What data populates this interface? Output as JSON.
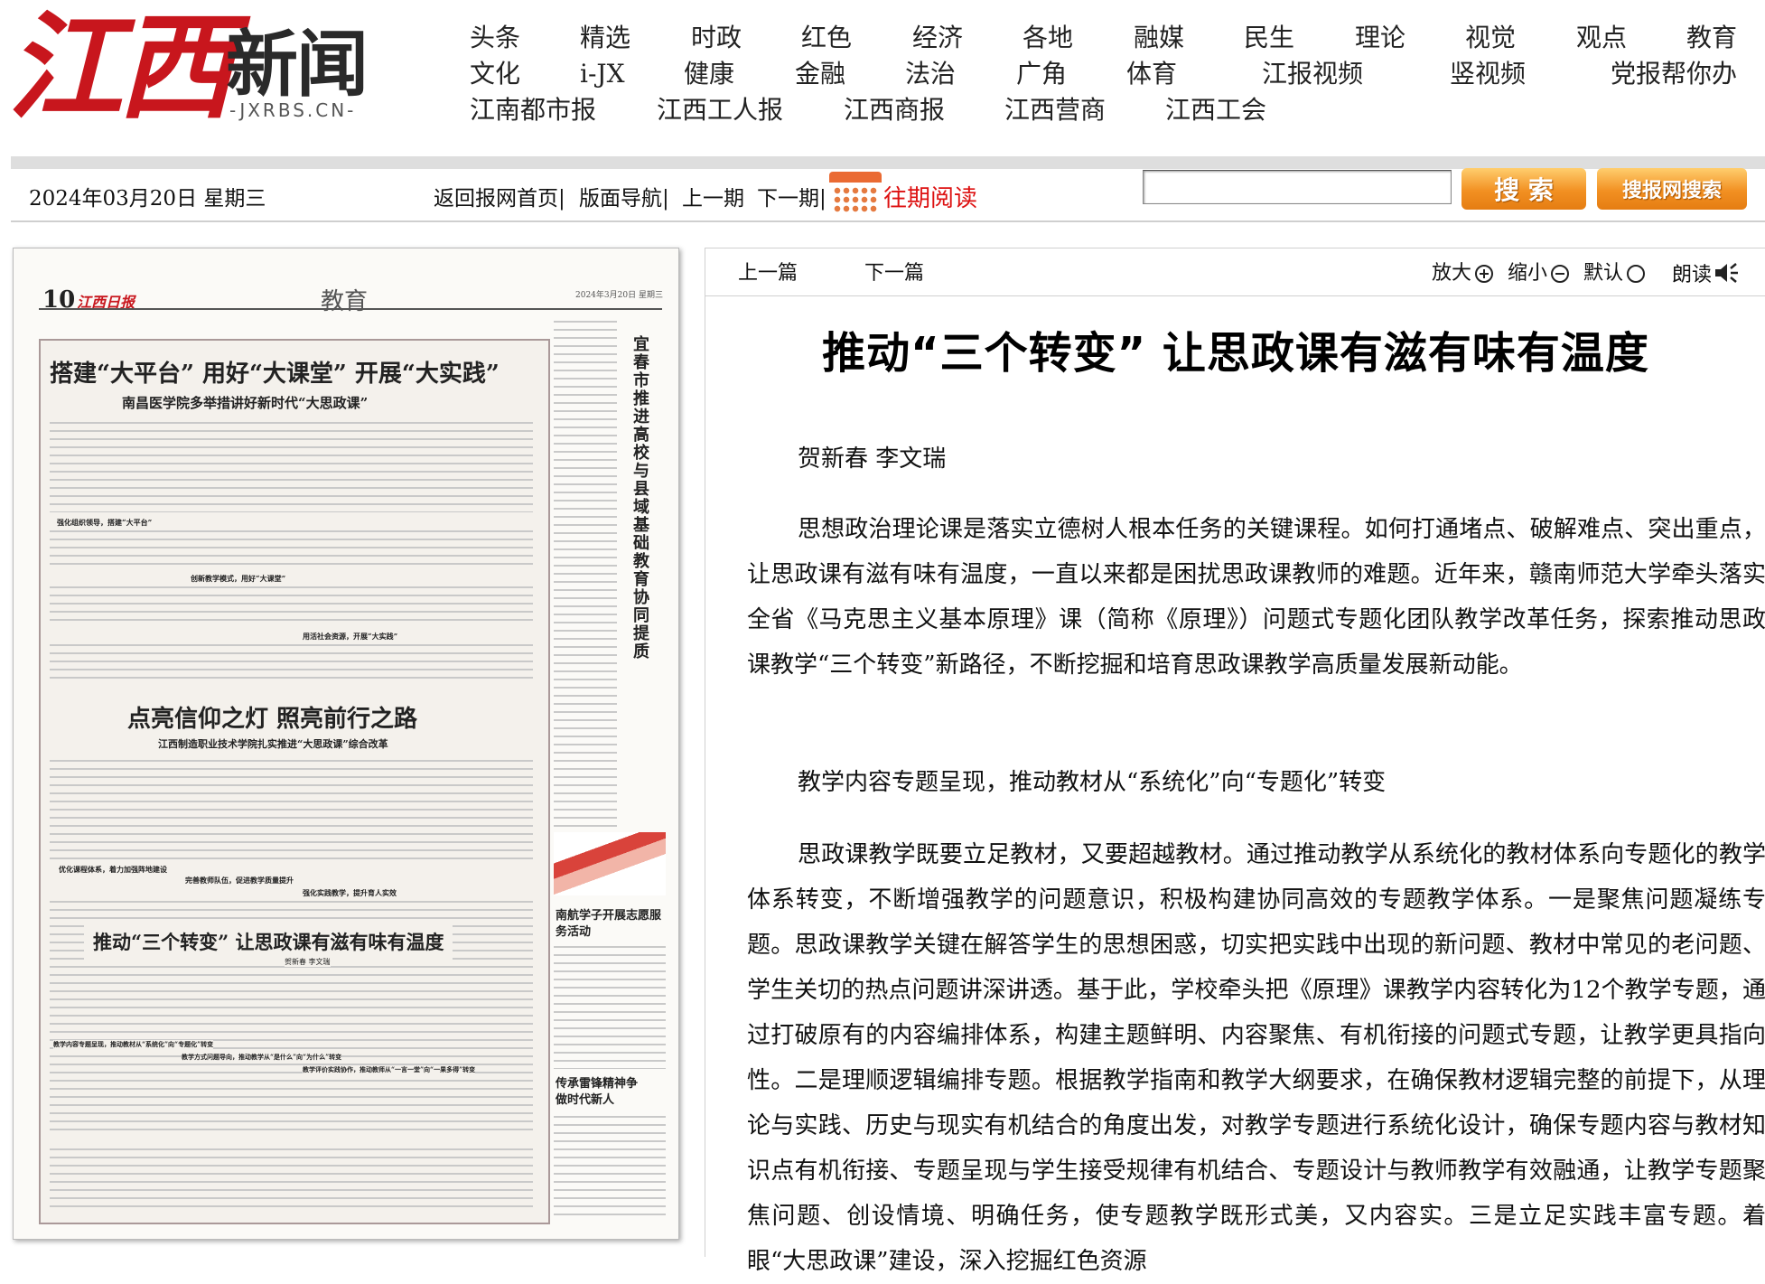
{
  "logo": {
    "cn": "江西",
    "xinwen": "新闻",
    "domain": "-JXRBS.CN-"
  },
  "nav": {
    "row1": [
      "头条",
      "精选",
      "时政",
      "红色",
      "经济",
      "各地",
      "融媒",
      "民生",
      "理论",
      "视觉",
      "观点",
      "教育"
    ],
    "row2": [
      "文化",
      "i-JX",
      "健康",
      "金融",
      "法治",
      "广角",
      "体育",
      "江报视频",
      "竖视频",
      "党报帮你办"
    ],
    "row3": [
      "江南都市报",
      "江西工人报",
      "江西商报",
      "江西营商",
      "江西工会"
    ]
  },
  "toolbar_top": {
    "date": "2024年03月20日 星期三",
    "home": "返回报网首页|",
    "layout_nav": "版面导航|",
    "prev_issue": "上一期",
    "next_issue": "下一期|",
    "past_reading": "往期阅读",
    "search_button": "搜 索",
    "site_search_button": "搜报网搜索"
  },
  "paper": {
    "page_no": "10",
    "paper_name": "江西日报",
    "section": "教育",
    "date_small": "2024年3月20日 星期三",
    "headline1": "搭建“大平台” 用好“大课堂” 开展“大实践”",
    "subhead1": "南昌医学院多举措讲好新时代“大思政课”",
    "sub1a": "强化组织领导，搭建“大平台”",
    "sub1b": "创新教学模式，用好“大课堂”",
    "sub1c": "用活社会资源，开展“大实践”",
    "headline2": "点亮信仰之灯 照亮前行之路",
    "subhead2": "江西制造职业技术学院扎实推进“大思政课”综合改革",
    "sub2a": "优化课程体系，着力加强阵地建设",
    "sub2b": "完善教师队伍，促进教学质量提升",
    "sub2c": "强化实践教学，提升育人实效",
    "headline3": "推动“三个转变” 让思政课有滋有味有温度",
    "author3": "贺新春 李文瑞",
    "sub3a": "教学内容专题呈现，推动教材从“系统化”向“专题化”转变",
    "sub3b": "教学方式问题导向，推动教学从“是什么”向“为什么”转变",
    "sub3c": "教学评价实践协作，推动教师从“一言一堂”向“一果多得”转变",
    "vertical_title": "宜春市推进高校与县域基础教育协同提质",
    "side2": "南航学子开展志愿服务活动",
    "side3": "传承雷锋精神争做时代新人"
  },
  "article_toolbar": {
    "prev": "上一篇",
    "next": "下一篇",
    "zoom_in": "放大",
    "zoom_out": "缩小",
    "default": "默认",
    "read_aloud": "朗读"
  },
  "article": {
    "title": "推动“三个转变” 让思政课有滋有味有温度",
    "byline": "贺新春 李文瑞",
    "p1": "思想政治理论课是落实立德树人根本任务的关键课程。如何打通堵点、破解难点、突出重点，让思政课有滋有味有温度，一直以来都是困扰思政课教师的难题。近年来，赣南师范大学牵头落实全省《马克思主义基本原理》课（简称《原理》）问题式专题化团队教学改革任务，探索推动思政课教学“三个转变”新路径，不断挖掘和培育思政课教学高质量发展新动能。",
    "p2": "教学内容专题呈现，推动教材从“系统化”向“专题化”转变",
    "p3": "思政课教学既要立足教材，又要超越教材。通过推动教学从系统化的教材体系向专题化的教学体系转变，不断增强教学的问题意识，积极构建协同高效的专题教学体系。一是聚焦问题凝练专题。思政课教学关键在解答学生的思想困惑，切实把实践中出现的新问题、教材中常见的老问题、学生关切的热点问题讲深讲透。基于此，学校牵头把《原理》课教学内容转化为12个教学专题，通过打破原有的内容编排体系，构建主题鲜明、内容聚焦、有机衔接的问题式专题，让教学更具指向性。二是理顺逻辑编排专题。根据教学指南和教学大纲要求，在确保教材逻辑完整的前提下，从理论与实践、历史与现实有机结合的角度出发，对教学专题进行系统化设计，确保专题内容与教材知识点有机衔接、专题呈现与学生接受规律有机结合、专题设计与教师教学有效融通，让教学专题聚焦问题、创设情境、明确任务，使专题教学既形式美，又内容实。三是立足实践丰富专题。着眼“大思政课”建设，深入挖掘红色资源"
  }
}
